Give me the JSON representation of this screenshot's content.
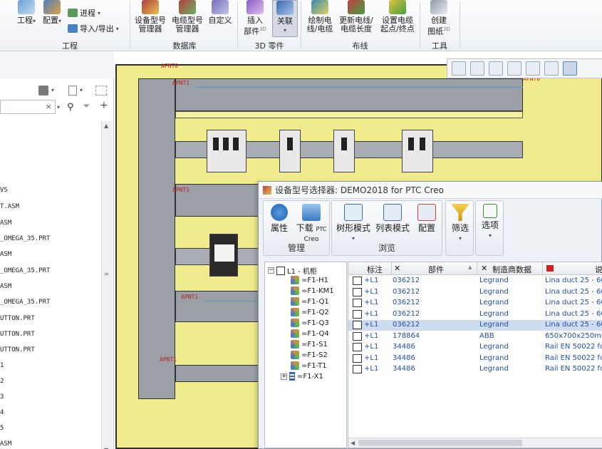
{
  "ribbon": {
    "btn_project": "工程",
    "btn_config": "配置",
    "btn_progress": "进程",
    "btn_import_export": "导入/导出",
    "btn_device_mgr": "设备型号\n管理器",
    "btn_cable_mgr": "电缆型号\n管理器",
    "btn_custom": "自定义",
    "btn_insert_part": "插入\n部件",
    "btn_insert_part_sup": "3D",
    "btn_associate": "关联",
    "btn_draw_cable": "绘制电\n线/电缆",
    "btn_update_length": "更新电线/\n电缆长度",
    "btn_set_endpoints": "设置电缆\n起点/终点",
    "btn_create_drawing": "创建\n图纸",
    "btn_create_drawing_sup": "2D",
    "groups": [
      "工程",
      "数据库",
      "3D 零件",
      "布线",
      "工具"
    ]
  },
  "left_panel": {
    "search_clear": "×",
    "lines": [
      "VS",
      "T.ASM",
      "ASM",
      "_OMEGA_35.PRT",
      "ASM",
      "_OMEGA_35.PRT",
      "ASM",
      "_OMEGA_35.PRT",
      "UTTON.PRT",
      "UTTON.PRT",
      "UTTON.PRT",
      "1",
      "2",
      "3",
      "4",
      "5",
      "ASM"
    ]
  },
  "viewport": {
    "apn_labels": [
      "APNT0",
      "APNT1",
      "APNT0",
      "APNT1",
      "APNT1",
      "APNT1"
    ]
  },
  "dialog": {
    "title": "设备型号选择器: DEMO2018 for PTC Creo",
    "btn_props": "属性",
    "btn_download": "下载",
    "btn_download_sup": "PTC",
    "btn_download_sub": "Creo",
    "btn_tree_mode": "树形模式",
    "btn_list_mode": "列表模式",
    "btn_config": "配置",
    "btn_filter": "筛选",
    "btn_options": "选项",
    "grp_manage": "管理",
    "grp_browse": "浏览",
    "tree": {
      "root": "L1 - 机柜",
      "children": [
        "=F1-H1",
        "=F1-KM1",
        "=F1-Q1",
        "=F1-Q2",
        "=F1-Q3",
        "=F1-Q4",
        "=F1-S1",
        "=F1-S2",
        "=F1-T1",
        "=F1-X1"
      ]
    },
    "table": {
      "columns": [
        "标注",
        "部件",
        "制造商数据",
        "说"
      ],
      "rows": [
        {
          "tag": "+L1",
          "part": "036212",
          "mfr": "Legrand",
          "desc": "Lina duct 25 - 60x"
        },
        {
          "tag": "+L1",
          "part": "036212",
          "mfr": "Legrand",
          "desc": "Lina duct 25 - 60x"
        },
        {
          "tag": "+L1",
          "part": "036212",
          "mfr": "Legrand",
          "desc": "Lina duct 25 - 60x"
        },
        {
          "tag": "+L1",
          "part": "036212",
          "mfr": "Legrand",
          "desc": "Lina duct 25 - 60x"
        },
        {
          "tag": "+L1",
          "part": "036212",
          "mfr": "Legrand",
          "desc": "Lina duct 25 - 60x"
        },
        {
          "tag": "+L1",
          "part": "178864",
          "mfr": "ABB",
          "desc": "650x700x250mm U"
        },
        {
          "tag": "+L1",
          "part": "34486",
          "mfr": "Legrand",
          "desc": "Rail EN 50022 for"
        },
        {
          "tag": "+L1",
          "part": "34486",
          "mfr": "Legrand",
          "desc": "Rail EN 50022 for"
        },
        {
          "tag": "+L1",
          "part": "34486",
          "mfr": "Legrand",
          "desc": "Rail EN 50022 for"
        }
      ],
      "selected_row": 4
    }
  },
  "colors": {
    "cabinet_yellow": "#f0ec8e",
    "duct_gray": "#9aa0a6",
    "selection": "#cfdcef",
    "link_blue": "#1f4fa8",
    "apn_red": "#b22222"
  }
}
